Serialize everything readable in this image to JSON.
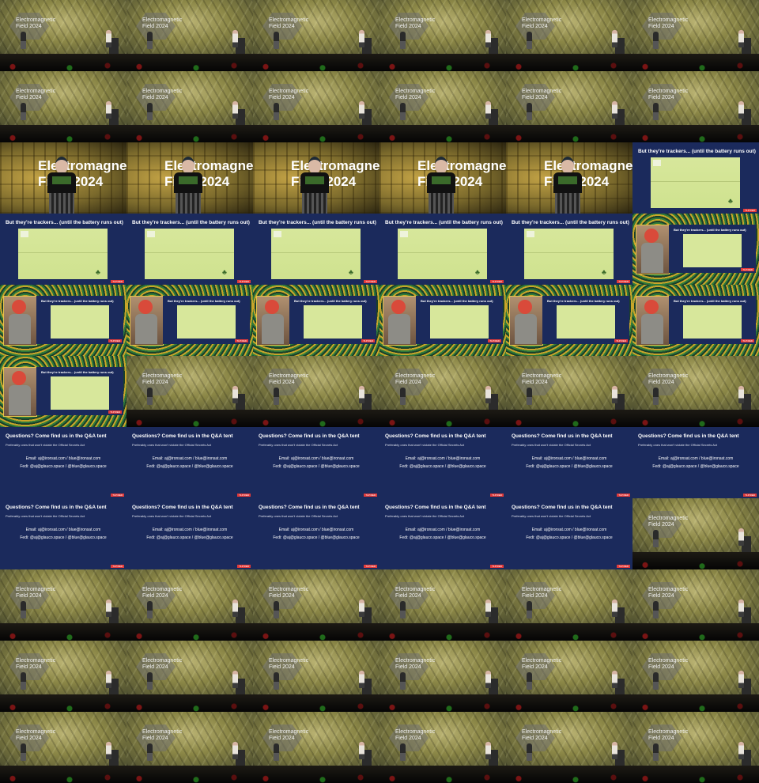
{
  "frames": [
    "stage",
    "stage",
    "stage",
    "stage",
    "stage",
    "stage",
    "stage",
    "stage",
    "stage",
    "stage",
    "stage",
    "stage",
    "closeup",
    "closeup",
    "closeup",
    "closeup",
    "closeup",
    "slide-trackers",
    "slide-trackers",
    "slide-trackers",
    "slide-trackers",
    "slide-trackers",
    "slide-trackers",
    "composite",
    "composite",
    "composite",
    "composite",
    "composite",
    "composite",
    "composite",
    "composite",
    "stage",
    "stage",
    "stage",
    "stage",
    "stage",
    "slide-qa",
    "slide-qa",
    "slide-qa",
    "slide-qa",
    "slide-qa",
    "slide-qa",
    "slide-qa",
    "slide-qa",
    "slide-qa",
    "slide-qa",
    "slide-qa",
    "stage",
    "stage",
    "stage",
    "stage",
    "stage",
    "stage",
    "stage",
    "stage",
    "stage",
    "stage",
    "stage",
    "stage",
    "stage",
    "stage",
    "stage",
    "stage",
    "stage",
    "stage",
    "stage"
  ],
  "stage_logo": "Electromagnetic\nField 2024",
  "closeup_title": "Electromagne\nField 2024",
  "trackers_slide": {
    "title": "But they're trackers... (until the battery runs out)",
    "tag": "TLP:RED"
  },
  "qa_slide": {
    "title": "Questions? Come find us in the Q&A tent",
    "subtitle": "Preferably ones that won't violate the Official Secrets Act",
    "email": "Email: aj@ironsat.com / blue@ironsat.com",
    "fedi": "Fedi: @aj@glauco.space / @blue@glauco.space",
    "tag": "TLP:RED"
  }
}
